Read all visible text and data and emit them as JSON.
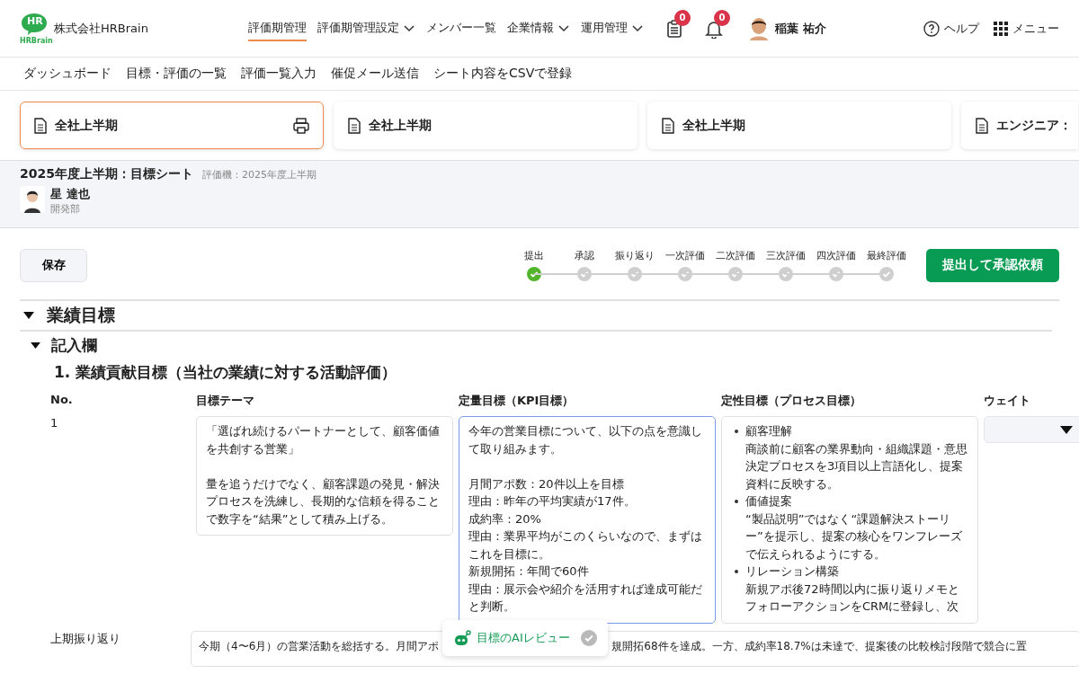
{
  "header": {
    "company": "株式会社HRBrain",
    "logo_text": "HR",
    "logo_sub": "HRBrain",
    "nav": [
      {
        "label": "評価期管理",
        "selected": true,
        "dropdown": false
      },
      {
        "label": "評価期管理設定",
        "selected": false,
        "dropdown": true
      },
      {
        "label": "メンバー一覧",
        "selected": false,
        "dropdown": false
      },
      {
        "label": "企業情報",
        "selected": false,
        "dropdown": true
      },
      {
        "label": "運用管理",
        "selected": false,
        "dropdown": true
      }
    ],
    "tasks_badge": "0",
    "notifications_badge": "0",
    "user_name": "稲葉 祐介",
    "help": "ヘルプ",
    "menu": "メニュー"
  },
  "subnav": [
    "ダッシュボード",
    "目標・評価の一覧",
    "評価一覧入力",
    "催促メール送信",
    "シート内容をCSVで登録"
  ],
  "sheet_tabs": [
    {
      "label": "全社上半期",
      "selected": true,
      "print": true
    },
    {
      "label": "全社上半期",
      "selected": false,
      "print": false
    },
    {
      "label": "全社上半期",
      "selected": false,
      "print": false
    },
    {
      "label": "エンジニア：",
      "selected": false,
      "print": false
    }
  ],
  "sheet": {
    "title": "2025年度上半期：目標シート",
    "period": "評価機：2025年度上半期",
    "member_name": "星 達也",
    "department": "開発部"
  },
  "save_button": "保存",
  "steps": [
    {
      "label": "提出",
      "done": true
    },
    {
      "label": "承認",
      "done": false
    },
    {
      "label": "振り返り",
      "done": false
    },
    {
      "label": "一次評価",
      "done": false
    },
    {
      "label": "二次評価",
      "done": false
    },
    {
      "label": "三次評価",
      "done": false
    },
    {
      "label": "四次評価",
      "done": false
    },
    {
      "label": "最終評価",
      "done": false
    }
  ],
  "submit_button": "提出して承認依頼",
  "section": {
    "title": "業績目標",
    "expanded": true,
    "subsection": "記入欄",
    "sub_expanded": true,
    "goal_title": "1. 業績貢献目標（当社の業績に対する活動評価）"
  },
  "columns": [
    "No.",
    "目標テーマ",
    "定量目標（KPI目標）",
    "定性目標（プロセス目標）",
    "ウェイト"
  ],
  "rows": [
    {
      "no": "1",
      "theme": [
        "「選ばれ続けるパートナーとして、顧客価値を共創する営業」",
        "量を追うだけでなく、顧客課題の発見・解決プロセスを洗練し、長期的な信頼を得ることで数字を“結果”として積み上げる。"
      ],
      "kpi": [
        [
          "今年の営業目標について、以下の点を意識して取り組みます。"
        ],
        [
          "月間アポ数：20件以上を目標",
          "理由：昨年の平均実績が17件。",
          "成約率：20%",
          "理由：業界平均がこのくらいなので、まずはこれを目標に。",
          "新規開拓：年間で60件",
          "理由：展示会や紹介を活用すれば達成可能だと判断。"
        ]
      ],
      "process": [
        {
          "title": "顧客理解",
          "text": "商談前に顧客の業界動向・組織課題・意思決定プロセスを3項目以上言語化し、提案資料に反映する。"
        },
        {
          "title": "価値提案",
          "text": "“製品説明”ではなく“課題解決ストーリー”を提示し、提案の核心をワンフレーズで伝えられるようにする。"
        },
        {
          "title": "リレーション構築",
          "text": "新規アポ後72時間以内に振り返りメモとフォローアクションをCRMに登録し、次"
        }
      ]
    }
  ],
  "reflection": {
    "label": "上期振り返り",
    "text_before": "今期（4〜6月）の営業活動を総括する。月間アポ",
    "text_after": "規開拓68件を達成。一方、成約率18.7%は未達で、提案後の比較検討段階で競合に置"
  },
  "ai_review": {
    "label": "目標のAIレビュー",
    "done": false
  }
}
